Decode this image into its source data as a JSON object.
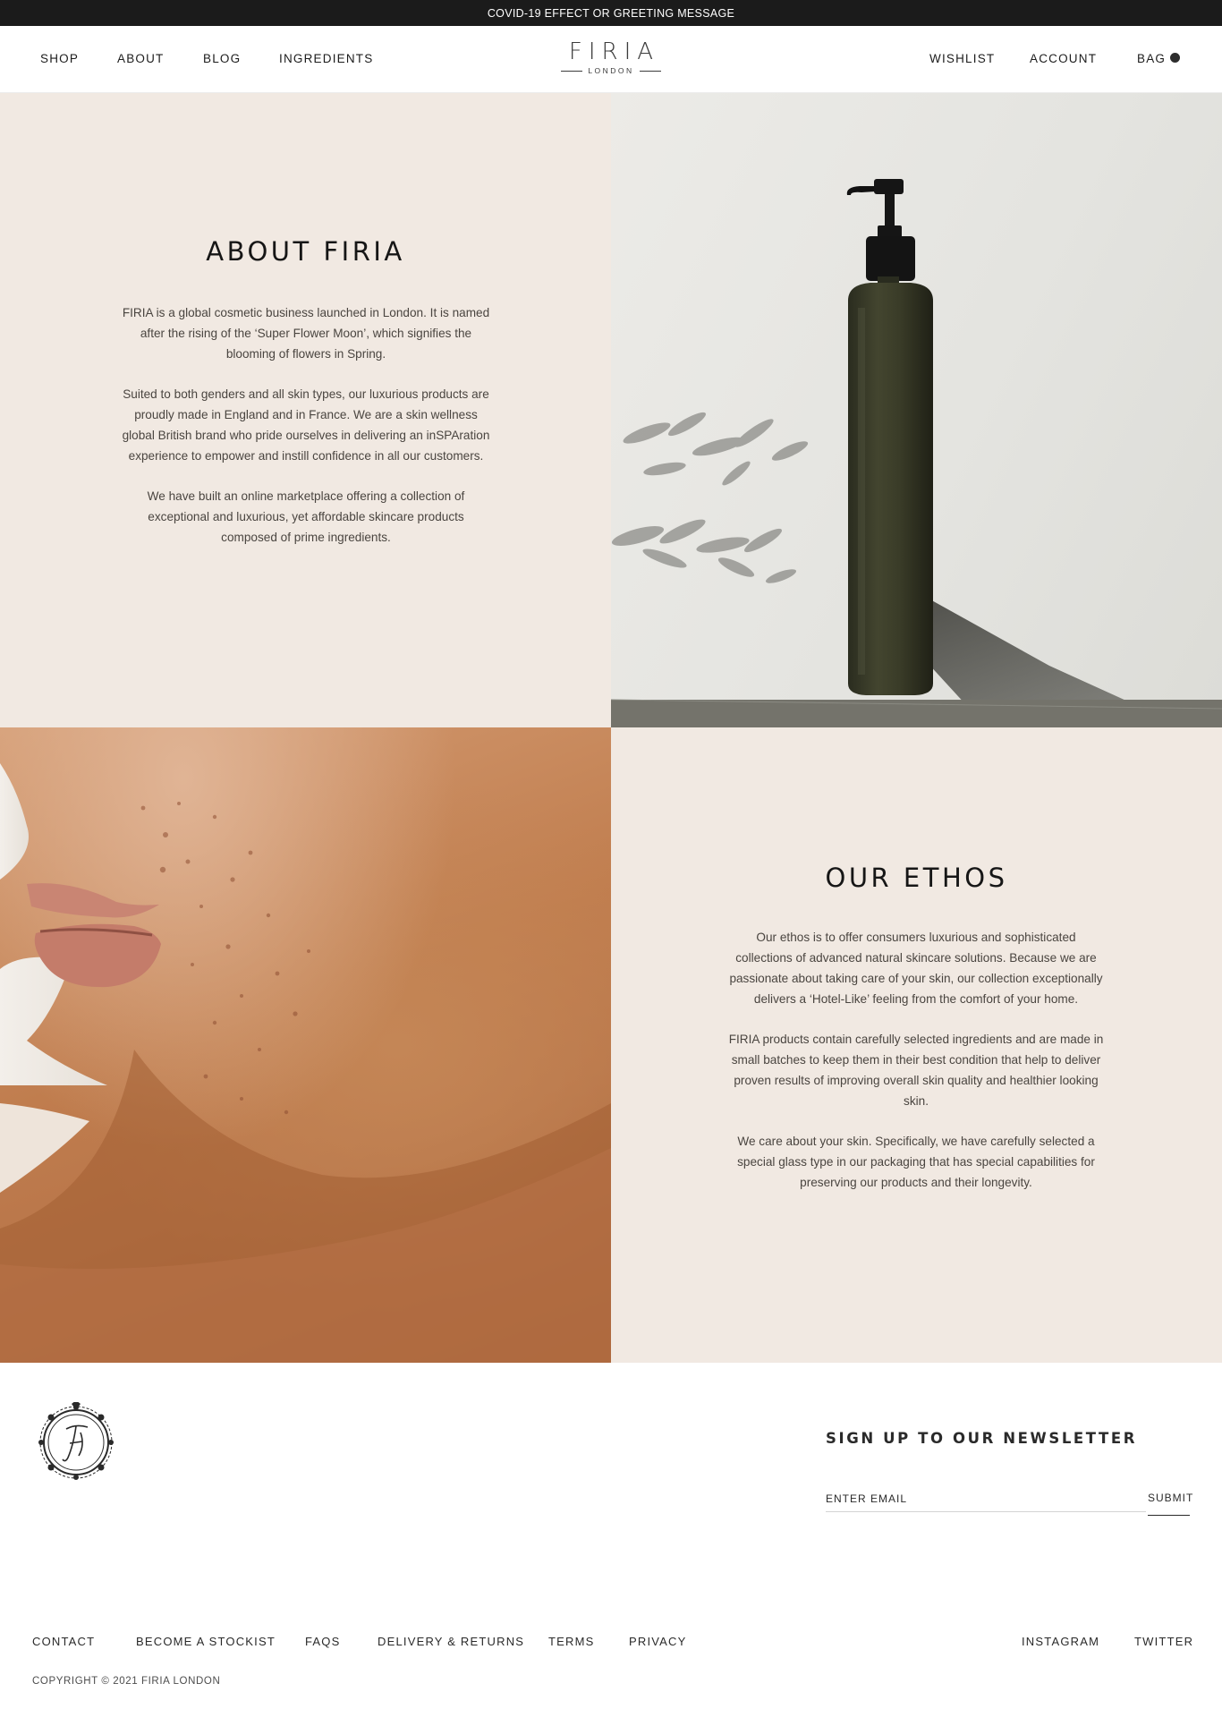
{
  "announcement": "COVID-19 EFFECT OR GREETING MESSAGE",
  "nav": {
    "left": [
      "SHOP",
      "ABOUT",
      "BLOG",
      "INGREDIENTS"
    ],
    "right": [
      "WISHLIST",
      "ACCOUNT",
      "BAG"
    ]
  },
  "logo": {
    "main": "FIRIA",
    "sub": "LONDON"
  },
  "about": {
    "title": "ABOUT FIRIA",
    "paragraphs": [
      "FIRIA is a global cosmetic business launched in London. It is named after the rising of the ‘Super Flower Moon’, which signifies the blooming of flowers in Spring.",
      "Suited to both genders and all skin types, our luxurious products are proudly made in England and in France. We are a skin wellness global British brand who pride ourselves in delivering an inSPAration experience to empower and instill confidence in all our customers.",
      "We have built an online marketplace offering a collection of exceptional and luxurious, yet affordable skincare products composed of prime ingredients."
    ]
  },
  "ethos": {
    "title": "OUR ETHOS",
    "paragraphs": [
      "Our ethos is to offer consumers luxurious and sophisticated collections of advanced natural skincare solutions. Because we are passionate about taking care of your skin, our collection exceptionally delivers a ‘Hotel-Like’ feeling from the comfort of your home.",
      "FIRIA products contain carefully selected ingredients and are made in small batches to keep them in their best condition that help to deliver proven results of improving overall skin quality and healthier looking skin.",
      "We care about your skin. Specifically, we have carefully selected a special glass type in our packaging that has special capabilities for preserving our products and their longevity."
    ]
  },
  "newsletter": {
    "title": "SIGN UP TO OUR NEWSLETTER",
    "placeholder": "ENTER EMAIL",
    "submit": "SUBMIT"
  },
  "footer": {
    "links": [
      "CONTACT",
      "BECOME A STOCKIST",
      "FAQS",
      "DELIVERY & RETURNS",
      "TERMS",
      "PRIVACY"
    ],
    "social": [
      "INSTAGRAM",
      "TWITTER"
    ],
    "copyright": "COPYRIGHT © 2021 FIRIA LONDON"
  },
  "colors": {
    "announcement_bg": "#1b1b1b",
    "panel_bg": "#f1e9e2",
    "text": "#1c1c1c"
  }
}
